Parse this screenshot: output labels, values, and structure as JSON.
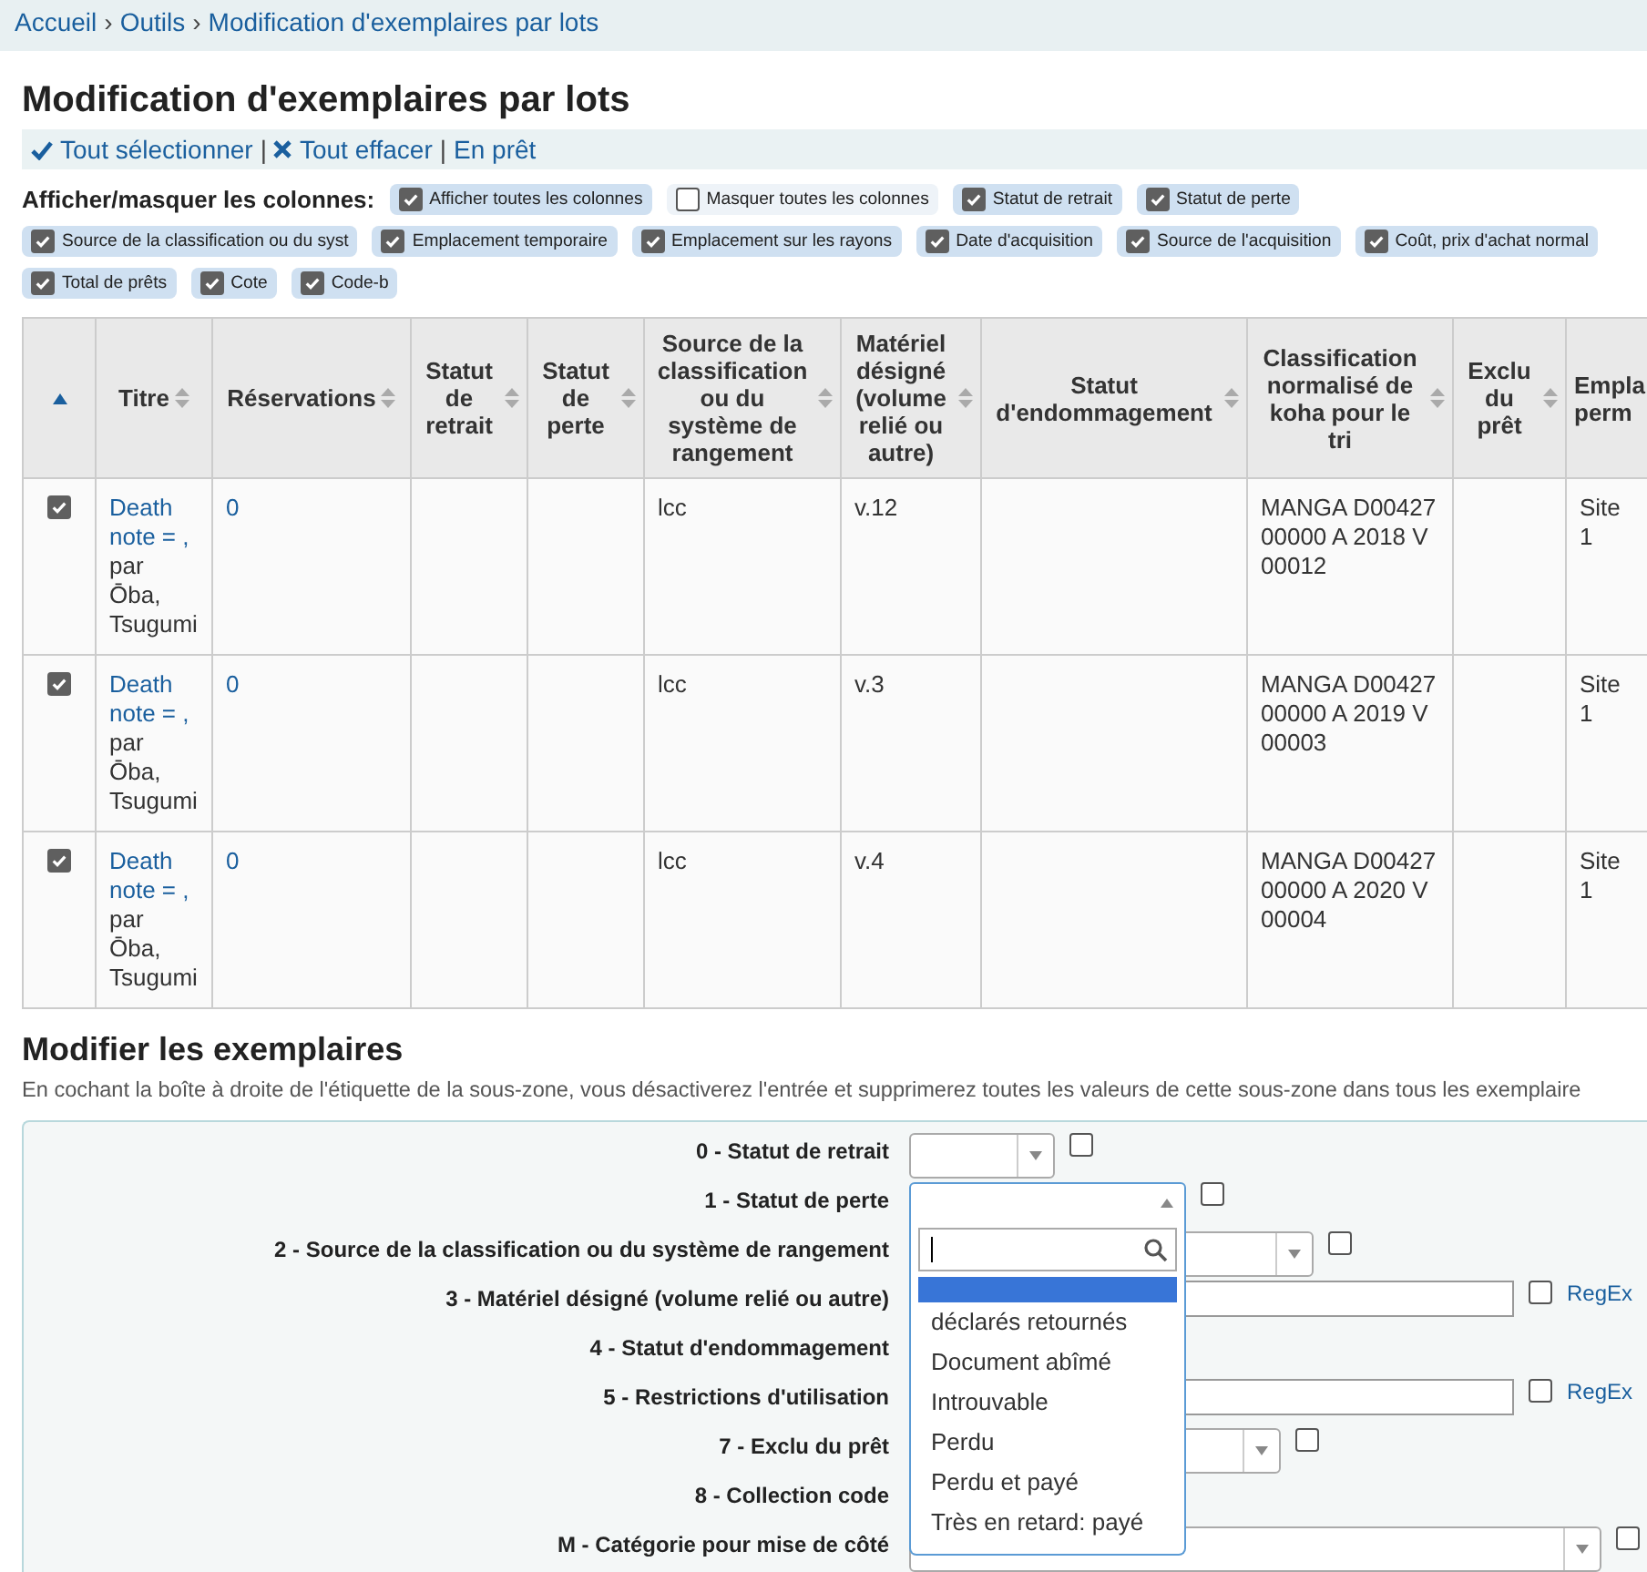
{
  "breadcrumb": {
    "separator": "›",
    "items": [
      "Accueil",
      "Outils",
      "Modification d'exemplaires par lots"
    ]
  },
  "title": "Modification d'exemplaires par lots",
  "actions": {
    "divider": "|",
    "items": [
      {
        "kind": "check",
        "label": "Tout sélectionner"
      },
      {
        "kind": "cross",
        "label": "Tout effacer"
      },
      {
        "kind": "plain",
        "label": "En prêt"
      }
    ]
  },
  "column_toggles": {
    "label": "Afficher/masquer les colonnes:",
    "items": [
      {
        "label": "Afficher toutes les colonnes",
        "checked": true
      },
      {
        "label": "Masquer toutes les colonnes",
        "checked": false
      },
      {
        "label": "Statut de retrait",
        "checked": true
      },
      {
        "label": "Statut de perte",
        "checked": true
      },
      {
        "label": "Source de la classification ou du syst",
        "checked": true
      },
      {
        "label": "Emplacement temporaire",
        "checked": true
      },
      {
        "label": "Emplacement sur les rayons",
        "checked": true
      },
      {
        "label": "Date d'acquisition",
        "checked": true
      },
      {
        "label": "Source de l'acquisition",
        "checked": true
      },
      {
        "label": "Coût, prix d'achat normal",
        "checked": true
      },
      {
        "label": "Total de prêts",
        "checked": true
      },
      {
        "label": "Cote",
        "checked": true
      },
      {
        "label": "Code-b",
        "checked": true
      }
    ]
  },
  "table": {
    "columns": [
      {
        "kind": "sorted"
      },
      {
        "label": "Titre",
        "kind": "sortable"
      },
      {
        "label": "Réservations",
        "kind": "sortable"
      },
      {
        "label": "Statut de retrait",
        "kind": "sortable"
      },
      {
        "label": "Statut de perte",
        "kind": "sortable"
      },
      {
        "label": "Source de la classification ou du système de rangement",
        "kind": "sortable"
      },
      {
        "label": "Matériel désigné (volume relié ou autre)",
        "kind": "sortable"
      },
      {
        "label": "Statut d'endommagement",
        "kind": "sortable"
      },
      {
        "label": "Classification normalisé de koha pour le tri",
        "kind": "sortable"
      },
      {
        "label": "Exclu du prêt",
        "kind": "sortable"
      },
      {
        "label": "Empla perm",
        "kind": "plain"
      }
    ],
    "rows": [
      {
        "cells": [
          {
            "checked": true
          },
          {
            "link": "Death note = ,",
            "author": "par Ōba, Tsugumi"
          },
          "0",
          "",
          "",
          "lcc",
          "v.12",
          "",
          "MANGA D00427 00000 A 2018 V 00012",
          "",
          "Site 1"
        ]
      },
      {
        "cells": [
          {
            "checked": true
          },
          {
            "link": "Death note = ,",
            "author": "par Ōba, Tsugumi"
          },
          "0",
          "",
          "",
          "lcc",
          "v.3",
          "",
          "MANGA D00427 00000 A 2019 V 00003",
          "",
          "Site 1"
        ]
      },
      {
        "cells": [
          {
            "checked": true
          },
          {
            "link": "Death note = ,",
            "author": "par Ōba, Tsugumi"
          },
          "0",
          "",
          "",
          "lcc",
          "v.4",
          "",
          "MANGA D00427 00000 A 2020 V 00004",
          "",
          "Site 1"
        ]
      }
    ]
  },
  "edit": {
    "title": "Modifier les exemplaires",
    "description": "En cochant la boîte à droite de l'étiquette de la sous-zone, vous désactiverez l'entrée et supprimerez toutes les valeurs de cette sous-zone dans tous les exemplaire",
    "fields": [
      {
        "label": "0 - Statut de retrait",
        "kind": "select",
        "checked": false
      },
      {
        "label": "1 - Statut de perte",
        "kind": "select",
        "open": true,
        "checked": false
      },
      {
        "label": "2 - Source de la classification ou du système de rangement",
        "kind": "select",
        "checked": false
      },
      {
        "label": "3 - Matériel désigné (volume relié ou autre)",
        "kind": "text",
        "checked": false,
        "regex": "RegEx"
      },
      {
        "label": "4 - Statut d'endommagement",
        "kind": "hidden"
      },
      {
        "label": "5 - Restrictions d'utilisation",
        "kind": "text",
        "checked": false,
        "regex": "RegEx"
      },
      {
        "label": "7 - Exclu du prêt",
        "kind": "select",
        "checked": false
      },
      {
        "label": "8 - Collection code",
        "kind": "hidden"
      },
      {
        "label": "M - Catégorie pour mise de côté",
        "kind": "select",
        "checked": false
      }
    ],
    "dropdown": {
      "blank_highlighted": true,
      "options": [
        {
          "label": "déclarés retournés",
          "highlighted": false
        },
        {
          "label": "Document abîmé",
          "highlighted": false
        },
        {
          "label": "Introuvable",
          "highlighted": false
        },
        {
          "label": "Perdu",
          "highlighted": false
        },
        {
          "label": "Perdu et payé",
          "highlighted": false
        },
        {
          "label": "Très en retard: payé",
          "highlighted": false
        }
      ]
    }
  }
}
